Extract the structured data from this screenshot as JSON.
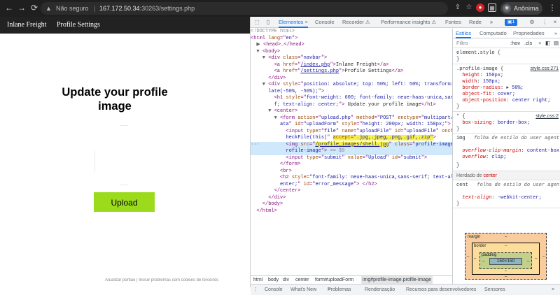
{
  "browser": {
    "address": {
      "warning": "Não seguro",
      "host": "167.172.50.34",
      "path": ":30263/settings.php"
    },
    "profile_label": "Anônima"
  },
  "page": {
    "nav_links": [
      "Inlane Freight",
      "Profile Settings"
    ],
    "title_line1": "Update your profile",
    "title_line2": "image",
    "upload_label": "Upload"
  },
  "devtools": {
    "tabs": [
      "Elementos",
      "Console",
      "Recorder ⚠",
      "Performance insights ⚠",
      "Fontes",
      "Rede"
    ],
    "badge": "1",
    "elements": {
      "doctype": "<!DOCTYPE html>",
      "head": "<head>…</head>",
      "navbar_class": "navbar",
      "link1_href": "/index.php",
      "link1_text": "Inlane Freight",
      "link2_href": "/settings.php",
      "link2_text": "Profile Settings",
      "div_style_a": "position: absolute; top: 50%; left: 50%; transform: trans",
      "div_style_b": "late(-50%, -50%);",
      "h1_style_a": "font-weight: 600; font-family: neue-haas-unica,sans-seri",
      "h1_style_b": "f; text-align: center;",
      "h1_text": "Update your profile image",
      "form_action": "upload.php",
      "form_method": "POST",
      "form_enctype_a": "multipart/form-d",
      "form_enctype_b": "ata",
      "form_id": "uploadForm",
      "form_style": "height: 200px; width: 150px;",
      "input_name": "uploadFile",
      "input_onchange_a": "c",
      "input_onchange_b": "heckFile(this)",
      "input_accept": ".jpg,.jpeg,.png,.gif,.zip",
      "img_src": "/profile_images/shell.jpg",
      "img_class": "profile-image",
      "img_id_a": "p",
      "img_id_b": "rofile-image",
      "dollar": "== $0",
      "submit_value": "Upload",
      "submit_id": "submit",
      "h2_style_a": "font-family: neue-haas-unica,sans-serif; text-align: c",
      "h2_style_b": "enter;",
      "h2_id": "error_message"
    },
    "breadcrumbs": [
      "html",
      "body",
      "div",
      "center",
      "form#uploadForm",
      "img#profile-image.profile-image"
    ],
    "styles": {
      "tabs": [
        "Estilos",
        "Computado",
        "Propriedades"
      ],
      "filter_placeholder": "Filtro",
      "hov": ":hov",
      "cls": ".cls",
      "element_style": "element.style {",
      "rule1_selector": ".profile-image {",
      "rule1_source": "style.css:271",
      "rule1_props": [
        [
          "height",
          "150px;"
        ],
        [
          "width",
          "150px;"
        ],
        [
          "border-radius",
          "50%;"
        ],
        [
          "object-fit",
          "cover;"
        ],
        [
          "object-position",
          "center right;"
        ]
      ],
      "rule2_selector": "* {",
      "rule2_source": "style.css:2",
      "rule2_prop": [
        "box-sizing",
        "border-box;"
      ],
      "ua_selector": "img",
      "ua_label": "folha de estilo do user agent",
      "ua_props": [
        [
          "overflow-clip-margin",
          "content-box;"
        ],
        [
          "overflow",
          "clip;"
        ]
      ],
      "inherited_label": "Herdado de",
      "inherited_from": "center",
      "ua2_selector": "cent",
      "ua2_label": "folha de estilo do user agent",
      "ua2_prop": [
        "text-align",
        "-webkit-center;"
      ],
      "box_model": {
        "margin_label": "margin",
        "border_label": "border",
        "padding_label": "padding",
        "content": "150×150",
        "dash": "–"
      }
    },
    "drawer_tabs": [
      "Console",
      "What's New",
      "Problemas",
      "Renderização",
      "Recursos para desenvolvedores",
      "Sensores"
    ],
    "drawer_peek": "Atualizar portião  |  Incluir problemas com cookies de terceiros"
  }
}
